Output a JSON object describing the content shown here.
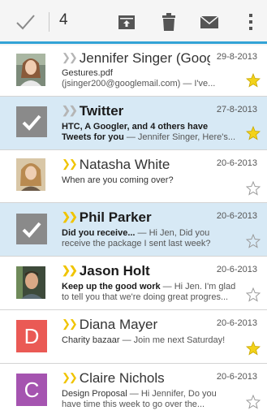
{
  "toolbar": {
    "selected_count": "4",
    "accent_color": "#33a3d6",
    "icons": [
      "checkmark-icon",
      "archive-icon",
      "trash-icon",
      "mark-unread-icon",
      "overflow-menu-icon"
    ]
  },
  "emails": [
    {
      "sender": "Jennifer Singer (Googlemail)",
      "date": "29-8-2013",
      "subject": "Gestures.pdf",
      "snippet": "(jsinger200@googlemail.com) — I've...",
      "unread": false,
      "selected": false,
      "important": false,
      "starred": true,
      "avatar": "photo-woman-1"
    },
    {
      "sender": "Twitter",
      "date": "27-8-2013",
      "subject": "HTC, A Googler, and 4 others have Tweets for you",
      "snippet": " — Jennifer Singer, Here's...",
      "unread": true,
      "selected": true,
      "important": false,
      "starred": true,
      "avatar": "check"
    },
    {
      "sender": "Natasha White",
      "date": "20-6-2013",
      "subject": "When are you coming over?",
      "snippet": "",
      "unread": false,
      "selected": false,
      "important": true,
      "starred": false,
      "avatar": "photo-woman-2"
    },
    {
      "sender": "Phil Parker",
      "date": "20-6-2013",
      "subject": "Did you receive...",
      "snippet": " — Hi Jen, Did you receive the package I sent last week?",
      "unread": true,
      "selected": true,
      "important": true,
      "starred": false,
      "avatar": "check"
    },
    {
      "sender": "Jason Holt",
      "date": "20-6-2013",
      "subject": "Keep up the good work",
      "snippet": " — Hi Jen. I'm glad to tell you that we're doing great progres...",
      "unread": true,
      "selected": false,
      "important": true,
      "starred": false,
      "avatar": "photo-man"
    },
    {
      "sender": "Diana Mayer",
      "date": "20-6-2013",
      "subject": "Charity bazaar",
      "snippet": " — Join me next Saturday!",
      "unread": false,
      "selected": false,
      "important": true,
      "starred": true,
      "avatar": "letter",
      "letter": "D",
      "letter_color": "#ea5a55"
    },
    {
      "sender": "Claire Nichols",
      "date": "20-6-2013",
      "subject": "Design Proposal",
      "snippet": " — Hi Jennifer, Do you have time this week to go over the...",
      "unread": false,
      "selected": false,
      "important": true,
      "starred": false,
      "avatar": "letter",
      "letter": "C",
      "letter_color": "#a554b0"
    }
  ]
}
